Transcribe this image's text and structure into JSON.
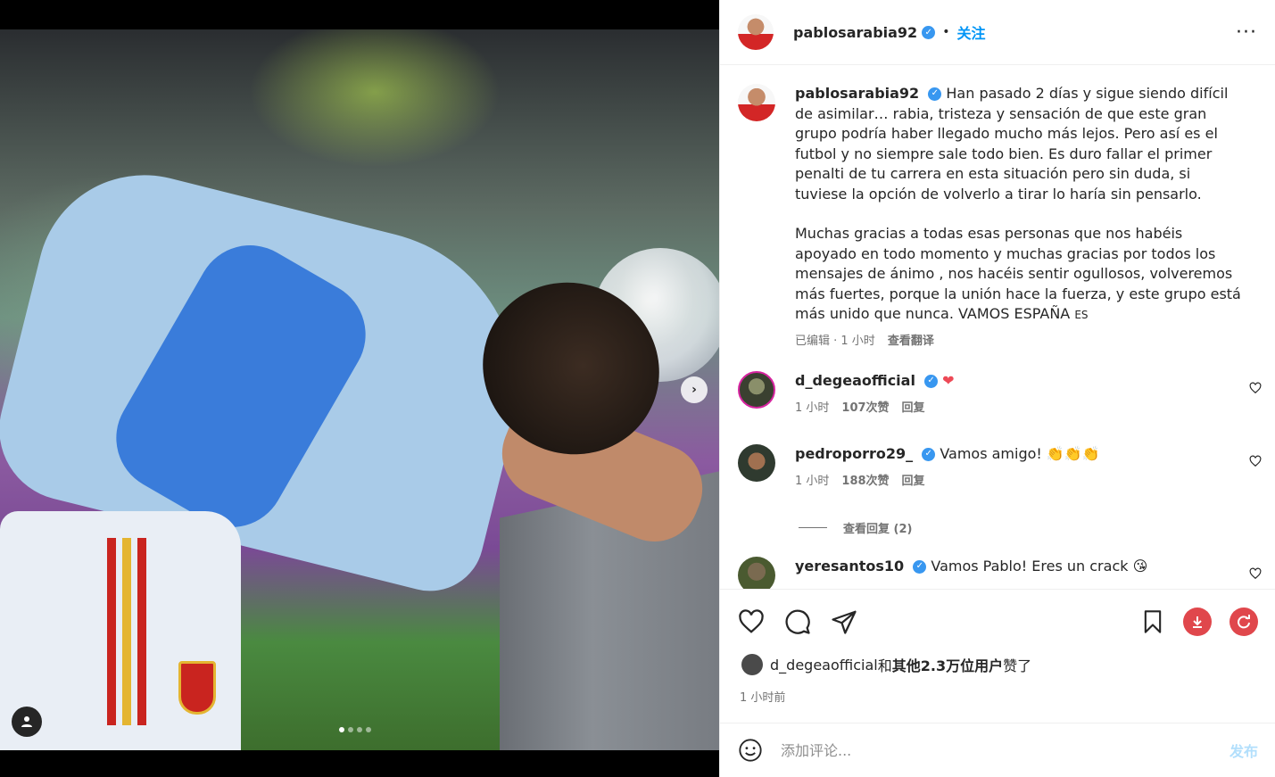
{
  "post": {
    "author": "pablosarabia92",
    "follow_label": "关注",
    "separator": "•",
    "more_icon": "more-icon"
  },
  "carousel": {
    "slide_count": 4,
    "active_index": 0,
    "next_icon": "chevron-right-icon",
    "tag_icon": "user-icon"
  },
  "caption": {
    "username": "pablosarabia92",
    "text_p1": "Han pasado 2 días y sigue siendo difícil de asimilar… rabia, tristeza y sensación de que este gran grupo podría haber llegado mucho más lejos. Pero así es el futbol y no siempre sale todo bien. Es duro fallar el primer penalti de tu carrera en esta situación pero sin duda, si tuviese la opción de volverlo a tirar lo haría sin pensarlo.",
    "text_p2": "Muchas gracias a todas esas personas que nos habéis apoyado en todo momento y muchas gracias por todos los mensajes de ánimo , nos hacéis sentir ogullosos, volveremos más fuertes, porque la unión hace la fuerza, y este grupo está más unido que nunca. VAMOS ESPAÑA",
    "flag": "ES",
    "edited": "已编辑 · 1 小时",
    "translate": "查看翻译"
  },
  "comments": [
    {
      "username": "d_degeaofficial",
      "text": "",
      "emoji": "❤",
      "time": "1 小时",
      "likes": "107次赞",
      "reply": "回复"
    },
    {
      "username": "pedroporro29_",
      "text": "Vamos amigo!",
      "emoji": "👏👏👏",
      "time": "1 小时",
      "likes": "188次赞",
      "reply": "回复"
    },
    {
      "username": "yeresantos10",
      "text": "Vamos Pablo! Eres un crack",
      "emoji": "😘"
    }
  ],
  "view_replies": "查看回复 (2)",
  "likes_summary": {
    "user": "d_degeaofficial",
    "and": "和",
    "others": "其他2.3万位用户",
    "suffix": "赞了"
  },
  "posted_time": "1 小时前",
  "composer": {
    "placeholder": "添加评论...",
    "post_label": "发布"
  },
  "colors": {
    "link_blue": "#0095f6",
    "verified_blue": "#3897f0",
    "like_red": "#ed4956",
    "download_red": "#e0474c"
  }
}
